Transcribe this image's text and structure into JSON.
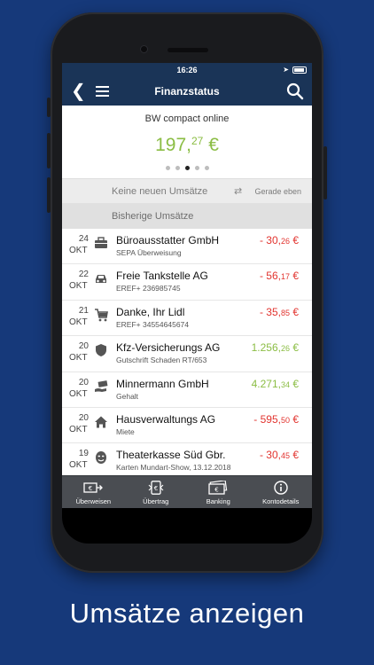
{
  "status_bar": {
    "time": "16:26",
    "location_glyph": "➤"
  },
  "navbar": {
    "title": "Finanzstatus",
    "back_glyph": "❮"
  },
  "account": {
    "name": "BW compact online",
    "balance_main": "197,",
    "balance_cents": "27",
    "balance_currency": " €",
    "page_count": 5,
    "active_page": 3
  },
  "sections": {
    "new_label": "Keine neuen Umsätze",
    "refresh_glyph": "⇄",
    "refresh_label": "Gerade eben",
    "history_label": "Bisherige Umsätze"
  },
  "transactions": [
    {
      "day": "24",
      "month": "OKT",
      "icon": "briefcase-icon",
      "name": "Büroausstatter GmbH",
      "sub": "SEPA Überweisung",
      "amount_main": "- 30,",
      "amount_cents": "26",
      "currency": " €",
      "sign": "neg"
    },
    {
      "day": "22",
      "month": "OKT",
      "icon": "car-icon",
      "name": "Freie Tankstelle AG",
      "sub": "EREF+ 236985745",
      "amount_main": "- 56,",
      "amount_cents": "17",
      "currency": " €",
      "sign": "neg"
    },
    {
      "day": "21",
      "month": "OKT",
      "icon": "cart-icon",
      "name": "Danke, Ihr Lidl",
      "sub": "EREF+ 34554645674",
      "amount_main": "- 35,",
      "amount_cents": "85",
      "currency": " €",
      "sign": "neg"
    },
    {
      "day": "20",
      "month": "OKT",
      "icon": "shield-icon",
      "name": "Kfz-Versicherungs AG",
      "sub": "Gutschrift Schaden RT/653",
      "amount_main": "1.256,",
      "amount_cents": "26",
      "currency": " €",
      "sign": "pos"
    },
    {
      "day": "20",
      "month": "OKT",
      "icon": "salary-icon",
      "name": "Minnermann GmbH",
      "sub": "Gehalt",
      "amount_main": "4.271,",
      "amount_cents": "34",
      "currency": " €",
      "sign": "pos"
    },
    {
      "day": "20",
      "month": "OKT",
      "icon": "house-icon",
      "name": "Hausverwaltungs AG",
      "sub": "Miete",
      "amount_main": "- 595,",
      "amount_cents": "50",
      "currency": " €",
      "sign": "neg"
    },
    {
      "day": "19",
      "month": "OKT",
      "icon": "theater-icon",
      "name": "Theaterkasse Süd Gbr.",
      "sub": "Karten Mundart-Show, 13.12.2018",
      "amount_main": "- 30,",
      "amount_cents": "45",
      "currency": " €",
      "sign": "neg"
    }
  ],
  "tabbar": [
    {
      "label": "Überweisen",
      "icon": "transfer-icon"
    },
    {
      "label": "Übertrag",
      "icon": "phone-transfer-icon"
    },
    {
      "label": "Banking",
      "icon": "banknote-icon"
    },
    {
      "label": "Kontodetails",
      "icon": "info-icon"
    }
  ],
  "caption": "Umsätze anzeigen",
  "colors": {
    "background": "#16397a",
    "nav": "#1a3457",
    "positive": "#8bbd44",
    "negative": "#e2342f"
  }
}
